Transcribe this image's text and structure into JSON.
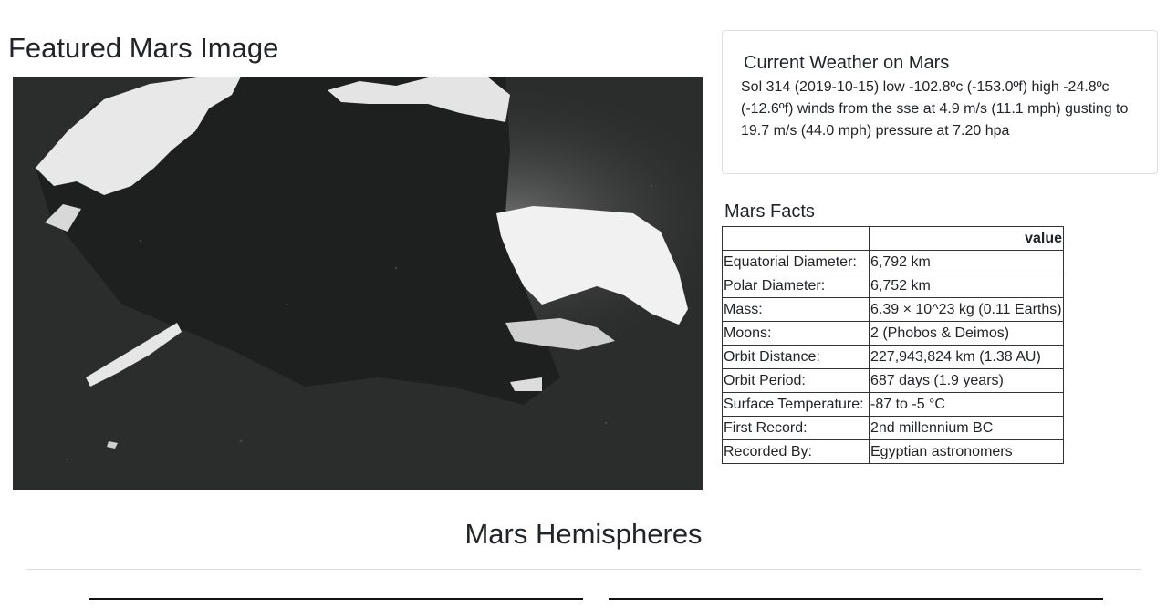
{
  "featured": {
    "title": "Featured Mars Image"
  },
  "weather": {
    "title": "Current Weather on Mars",
    "text": "Sol 314 (2019-10-15) low -102.8ºc (-153.0ºf) high -24.8ºc (-12.6ºf) winds from the sse at 4.9 m/s (11.1 mph) gusting to 19.7 m/s (44.0 mph) pressure at 7.20 hpa"
  },
  "facts": {
    "title": "Mars Facts",
    "header": [
      "",
      "value"
    ],
    "rows": [
      {
        "label": "Equatorial Diameter:",
        "value": "6,792 km"
      },
      {
        "label": "Polar Diameter:",
        "value": "6,752 km"
      },
      {
        "label": "Mass:",
        "value": "6.39 × 10^23 kg (0.11 Earths)"
      },
      {
        "label": "Moons:",
        "value": "2 (Phobos & Deimos)"
      },
      {
        "label": "Orbit Distance:",
        "value": "227,943,824 km (1.38 AU)"
      },
      {
        "label": "Orbit Period:",
        "value": "687 days (1.9 years)"
      },
      {
        "label": "Surface Temperature:",
        "value": "-87 to -5 °C"
      },
      {
        "label": "First Record:",
        "value": "2nd millennium BC"
      },
      {
        "label": "Recorded By:",
        "value": "Egyptian astronomers"
      }
    ]
  },
  "hemispheres": {
    "title": "Mars Hemispheres"
  }
}
